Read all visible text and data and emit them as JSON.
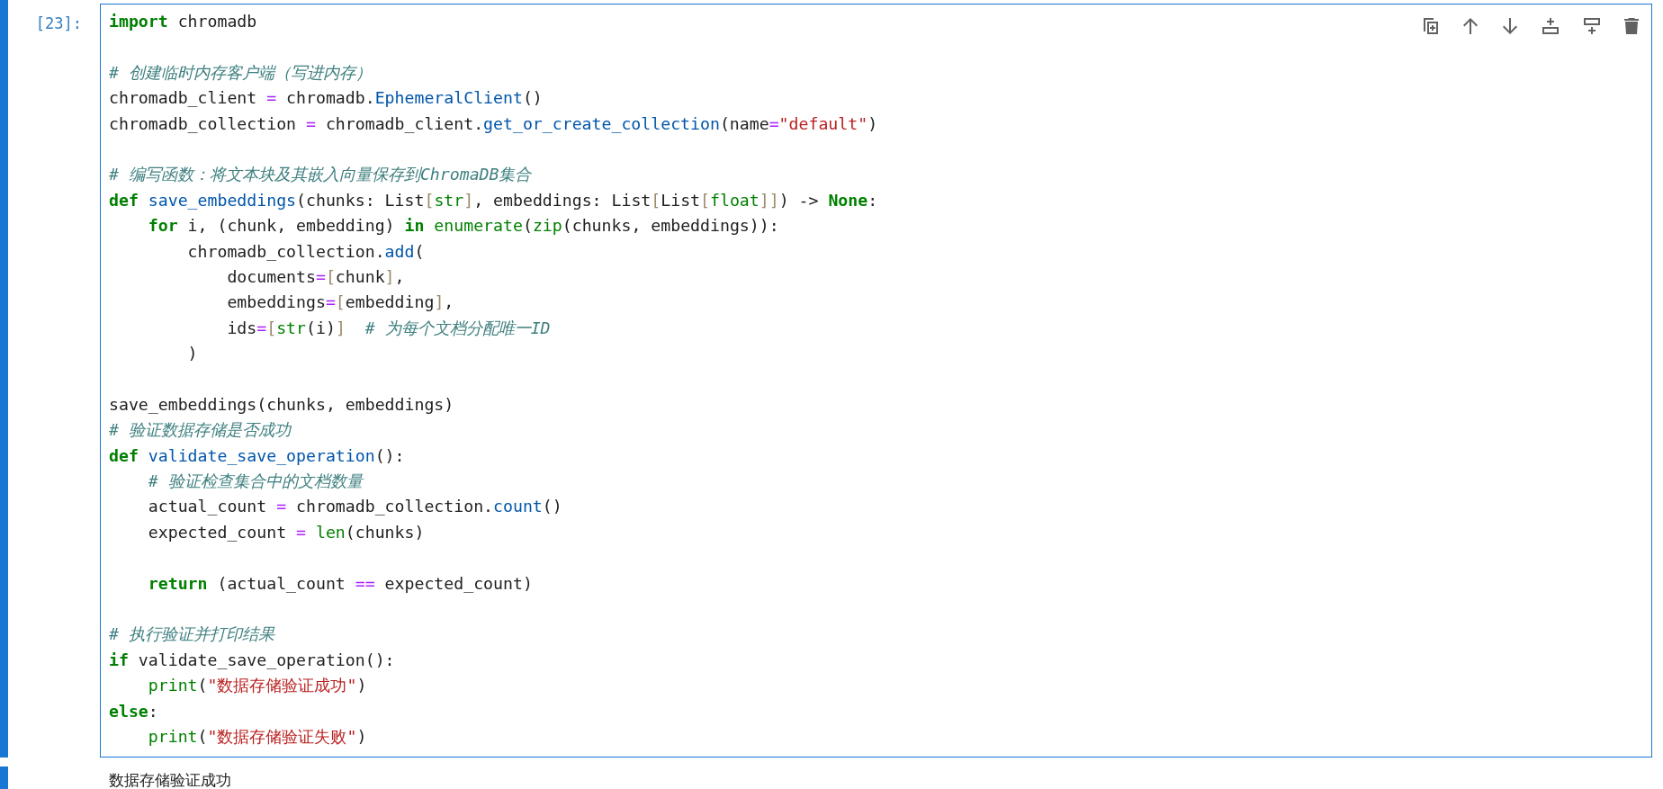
{
  "cell": {
    "prompt": "[23]:",
    "selected": true,
    "lines": [
      {
        "kind": "code",
        "tokens": [
          {
            "kind": "keyword",
            "text": "import"
          },
          {
            "kind": "plain",
            "text": " chromadb"
          }
        ]
      },
      {
        "kind": "blank"
      },
      {
        "kind": "code",
        "tokens": [
          {
            "kind": "comment",
            "text": "# 创建临时内存客户端（写进内存）"
          }
        ]
      },
      {
        "kind": "code",
        "tokens": [
          {
            "kind": "plain",
            "text": "chromadb_client "
          },
          {
            "kind": "operator",
            "text": "="
          },
          {
            "kind": "plain",
            "text": " chromadb."
          },
          {
            "kind": "name",
            "text": "EphemeralClient"
          },
          {
            "kind": "plain",
            "text": "()"
          }
        ]
      },
      {
        "kind": "code",
        "tokens": [
          {
            "kind": "plain",
            "text": "chromadb_collection "
          },
          {
            "kind": "operator",
            "text": "="
          },
          {
            "kind": "plain",
            "text": " chromadb_client."
          },
          {
            "kind": "name",
            "text": "get_or_create_collection"
          },
          {
            "kind": "plain",
            "text": "(name"
          },
          {
            "kind": "operator",
            "text": "="
          },
          {
            "kind": "string",
            "text": "\"default\""
          },
          {
            "kind": "plain",
            "text": ")"
          }
        ]
      },
      {
        "kind": "blank"
      },
      {
        "kind": "code",
        "tokens": [
          {
            "kind": "comment",
            "text": "# 编写函数：将文本块及其嵌入向量保存到ChromaDB集合"
          }
        ]
      },
      {
        "kind": "code",
        "tokens": [
          {
            "kind": "keyword",
            "text": "def "
          },
          {
            "kind": "name",
            "text": "save_embeddings"
          },
          {
            "kind": "plain",
            "text": "(chunks: List"
          },
          {
            "kind": "bracket",
            "text": "["
          },
          {
            "kind": "builtin",
            "text": "str"
          },
          {
            "kind": "bracket",
            "text": "]"
          },
          {
            "kind": "plain",
            "text": ", embeddings: List"
          },
          {
            "kind": "bracket",
            "text": "["
          },
          {
            "kind": "plain",
            "text": "List"
          },
          {
            "kind": "bracket",
            "text": "["
          },
          {
            "kind": "builtin",
            "text": "float"
          },
          {
            "kind": "bracket",
            "text": "]]"
          },
          {
            "kind": "plain",
            "text": ") -> "
          },
          {
            "kind": "keyword",
            "text": "None"
          },
          {
            "kind": "plain",
            "text": ":"
          }
        ]
      },
      {
        "kind": "code",
        "tokens": [
          {
            "kind": "keyword",
            "text": "    for"
          },
          {
            "kind": "plain",
            "text": " i, (chunk, embedding) "
          },
          {
            "kind": "keyword",
            "text": "in"
          },
          {
            "kind": "builtin",
            "text": " enumerate"
          },
          {
            "kind": "plain",
            "text": "("
          },
          {
            "kind": "builtin",
            "text": "zip"
          },
          {
            "kind": "plain",
            "text": "(chunks, embeddings)):"
          }
        ]
      },
      {
        "kind": "code",
        "tokens": [
          {
            "kind": "plain",
            "text": "        chromadb_collection."
          },
          {
            "kind": "name",
            "text": "add"
          },
          {
            "kind": "plain",
            "text": "("
          }
        ]
      },
      {
        "kind": "code",
        "tokens": [
          {
            "kind": "plain",
            "text": "            documents"
          },
          {
            "kind": "operator",
            "text": "="
          },
          {
            "kind": "bracket",
            "text": "["
          },
          {
            "kind": "plain",
            "text": "chunk"
          },
          {
            "kind": "bracket",
            "text": "]"
          },
          {
            "kind": "plain",
            "text": ","
          }
        ]
      },
      {
        "kind": "code",
        "tokens": [
          {
            "kind": "plain",
            "text": "            embeddings"
          },
          {
            "kind": "operator",
            "text": "="
          },
          {
            "kind": "bracket",
            "text": "["
          },
          {
            "kind": "plain",
            "text": "embedding"
          },
          {
            "kind": "bracket",
            "text": "]"
          },
          {
            "kind": "plain",
            "text": ","
          }
        ]
      },
      {
        "kind": "code",
        "tokens": [
          {
            "kind": "plain",
            "text": "            ids"
          },
          {
            "kind": "operator",
            "text": "="
          },
          {
            "kind": "bracket",
            "text": "["
          },
          {
            "kind": "builtin",
            "text": "str"
          },
          {
            "kind": "plain",
            "text": "(i)"
          },
          {
            "kind": "bracket",
            "text": "]"
          },
          {
            "kind": "comment",
            "text": "  # 为每个文档分配唯一ID"
          }
        ]
      },
      {
        "kind": "code",
        "tokens": [
          {
            "kind": "plain",
            "text": "        )"
          }
        ]
      },
      {
        "kind": "blank"
      },
      {
        "kind": "code",
        "tokens": [
          {
            "kind": "plain",
            "text": "save_embeddings(chunks, embeddings)"
          }
        ]
      },
      {
        "kind": "code",
        "tokens": [
          {
            "kind": "comment",
            "text": "# 验证数据存储是否成功"
          }
        ]
      },
      {
        "kind": "code",
        "tokens": [
          {
            "kind": "keyword",
            "text": "def "
          },
          {
            "kind": "name",
            "text": "validate_save_operation"
          },
          {
            "kind": "plain",
            "text": "():"
          }
        ]
      },
      {
        "kind": "code",
        "tokens": [
          {
            "kind": "comment",
            "text": "    # 验证检查集合中的文档数量"
          }
        ]
      },
      {
        "kind": "code",
        "tokens": [
          {
            "kind": "plain",
            "text": "    actual_count "
          },
          {
            "kind": "operator",
            "text": "="
          },
          {
            "kind": "plain",
            "text": " chromadb_collection."
          },
          {
            "kind": "name",
            "text": "count"
          },
          {
            "kind": "plain",
            "text": "()"
          }
        ]
      },
      {
        "kind": "code",
        "tokens": [
          {
            "kind": "plain",
            "text": "    expected_count "
          },
          {
            "kind": "operator",
            "text": "="
          },
          {
            "kind": "builtin",
            "text": " len"
          },
          {
            "kind": "plain",
            "text": "(chunks)"
          }
        ]
      },
      {
        "kind": "blank"
      },
      {
        "kind": "code",
        "tokens": [
          {
            "kind": "keyword",
            "text": "    return"
          },
          {
            "kind": "plain",
            "text": " (actual_count "
          },
          {
            "kind": "operator",
            "text": "=="
          },
          {
            "kind": "plain",
            "text": " expected_count)"
          }
        ]
      },
      {
        "kind": "blank"
      },
      {
        "kind": "code",
        "tokens": [
          {
            "kind": "comment",
            "text": "# 执行验证并打印结果"
          }
        ]
      },
      {
        "kind": "code",
        "tokens": [
          {
            "kind": "keyword",
            "text": "if"
          },
          {
            "kind": "plain",
            "text": " validate_save_operation():"
          }
        ]
      },
      {
        "kind": "code",
        "tokens": [
          {
            "kind": "builtin",
            "text": "    print"
          },
          {
            "kind": "plain",
            "text": "("
          },
          {
            "kind": "string",
            "text": "\"数据存储验证成功\""
          },
          {
            "kind": "plain",
            "text": ")"
          }
        ]
      },
      {
        "kind": "code",
        "tokens": [
          {
            "kind": "keyword",
            "text": "else"
          },
          {
            "kind": "plain",
            "text": ":"
          }
        ]
      },
      {
        "kind": "code",
        "tokens": [
          {
            "kind": "builtin",
            "text": "    print"
          },
          {
            "kind": "plain",
            "text": "("
          },
          {
            "kind": "string",
            "text": "\"数据存储验证失败\""
          },
          {
            "kind": "plain",
            "text": ")"
          }
        ]
      }
    ],
    "output": "数据存储验证成功"
  }
}
